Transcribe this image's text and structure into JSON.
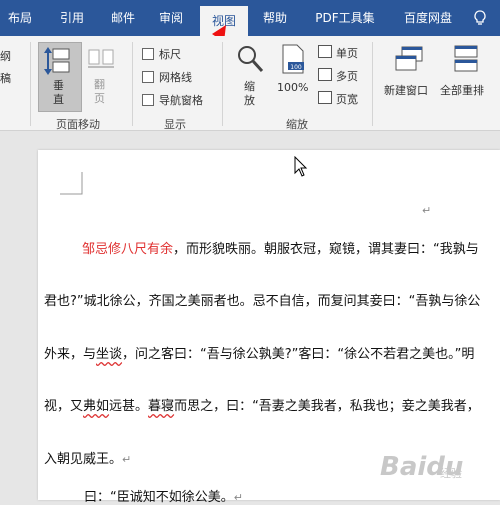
{
  "tabs": [
    {
      "label": "布局"
    },
    {
      "label": "引用"
    },
    {
      "label": "邮件"
    },
    {
      "label": "审阅"
    },
    {
      "label": "视图"
    },
    {
      "label": "帮助"
    },
    {
      "label": "PDF工具集"
    },
    {
      "label": "百度网盘"
    }
  ],
  "ribbon": {
    "left_partial": [
      "纲",
      "稿"
    ],
    "page_move": {
      "vertical": "垂\n直",
      "flip": "翻\n页",
      "group_label": "页面移动"
    },
    "show": {
      "ruler": "标尺",
      "gridlines": "网格线",
      "nav_pane": "导航窗格",
      "group_label": "显示"
    },
    "zoom": {
      "zoom_label": "缩\n放",
      "percent": "100%",
      "one_page": "单页",
      "multi_page": "多页",
      "page_width": "页宽",
      "group_label": "缩放"
    },
    "window": {
      "new_window": "新建窗口",
      "arrange_all": "全部重排"
    }
  },
  "document": {
    "line1_red": "邹忌修八尺有余",
    "line1_rest": "，而形貌昳丽。朝服衣冠，窥镜，谓其妻曰：“我孰与",
    "line2": "君也?”城北徐公，齐国之美丽者也。忌不自信，而复问其妾曰：“吾孰与徐公",
    "line3a": "外来，与",
    "line3b": "坐谈",
    "line3c": "，问之客曰：“吾与徐公孰美?”客曰：“徐公不若君之美也。”明",
    "line4a": "视，又",
    "line4b": "弗如",
    "line4c": "远甚。",
    "line4d": "暮寝",
    "line4e": "而思之，曰：“吾妻之美我者，私我也；妾之美我者，",
    "line5": "入朝见威王。",
    "line6a": "曰：“",
    "line6b": "臣诚知不如徐公美。",
    "para_mark": "↵"
  },
  "watermark": {
    "text": "Baidu",
    "sub": "经验"
  }
}
